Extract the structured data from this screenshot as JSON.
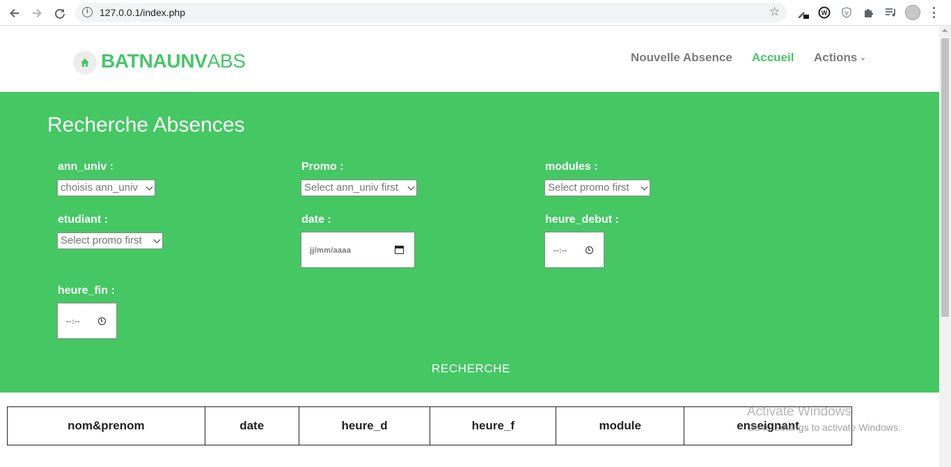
{
  "browser": {
    "url": "127.0.0.1/index.php"
  },
  "header": {
    "logo_bold": "BATNAUNV",
    "logo_light": "ABS",
    "nav": {
      "nouvelle_absence": "Nouvelle Absence",
      "accueil": "Accueil",
      "actions": "Actions"
    }
  },
  "search_form": {
    "title": "Recherche Absences",
    "ann_univ": {
      "label": "ann_univ :",
      "value": "choisis ann_univ"
    },
    "promo": {
      "label": "Promo :",
      "value": "Select ann_univ first"
    },
    "modules": {
      "label": "modules :",
      "value": "Select promo first"
    },
    "etudiant": {
      "label": "etudiant :",
      "value": "Select promo first"
    },
    "date": {
      "label": "date :",
      "placeholder": "jj/mm/aaaa"
    },
    "heure_debut": {
      "label": "heure_debut :",
      "placeholder": "--:--"
    },
    "heure_fin": {
      "label": "heure_fin :",
      "placeholder": "--:--"
    },
    "submit_label": "RECHERCHE"
  },
  "results_table": {
    "columns": [
      "nom&prenom",
      "date",
      "heure_d",
      "heure_f",
      "module",
      "enseignant"
    ]
  },
  "os_watermark": {
    "line1": "Activate Windows",
    "line2": "Go to Settings to activate Windows."
  },
  "colors": {
    "brand_green": "#45c764",
    "nav_gray": "#7a7a7a"
  }
}
